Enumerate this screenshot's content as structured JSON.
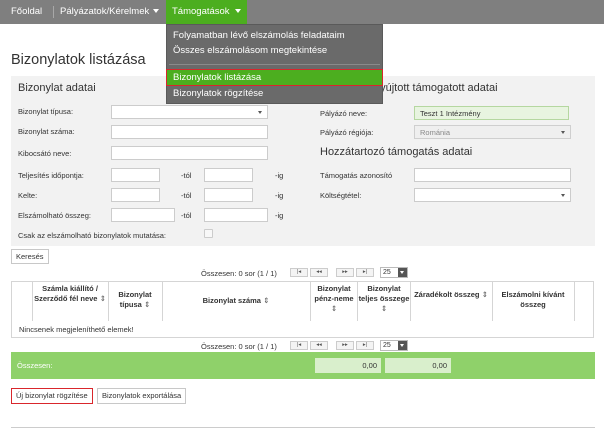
{
  "nav": {
    "home": "Főoldal",
    "requests": "Pályázatok/Kérelmek",
    "subsidies": "Támogatások"
  },
  "dropdown": {
    "items": [
      "Folyamatban lévő elszámolás feladataim",
      "Összes elszámolásom megtekintése",
      "Bizonylatok listázása",
      "Bizonylatok rögzítése"
    ],
    "selected_index": 2
  },
  "page": {
    "title": "Bizonylatok listázása"
  },
  "doc_section": {
    "title": "Bizonylat adatai",
    "type_label": "Bizonylat típusa:",
    "number_label": "Bizonylat száma:",
    "issuer_label": "Kibocsátó neve:",
    "performance_label": "Teljesítés időpontja:",
    "date_label": "Kelte:",
    "amount_label": "Elszámolható összeg:",
    "from_suffix": "-tól",
    "to_suffix": "-ig",
    "only_eligible_label": "Csak az elszámolható bizonylatok mutatása:"
  },
  "applicant_section": {
    "title": "...nyújtott támogatott adatai",
    "title_visible": "nyújtott támogatott adatai",
    "name_label": "Pályázó neve:",
    "name_value": "Teszt 1 Intézmény",
    "region_label": "Pályázó régiója:",
    "region_value": "Románia"
  },
  "support_section": {
    "title": "Hozzátartozó támogatás adatai",
    "id_label": "Támogatás azonosító",
    "cost_label": "Költségtétel:"
  },
  "search_button": "Keresés",
  "pager": {
    "summary": "Összesen: 0 sor (1 / 1)",
    "page_size": "25",
    "first": "|◂",
    "prev": "◂◂",
    "next": "▸▸",
    "last": "▸|"
  },
  "table": {
    "headers": [
      "Számla kiállító / Szerződő fél neve",
      "Bizonylat típusa",
      "Bizonylat száma",
      "Bizonylat pénz-neme",
      "Bizonylat teljes összege",
      "Záradékolt összeg",
      "Elszámolni kívánt összeg"
    ],
    "sort_icon": "⇕",
    "empty_text": "Nincsenek megjeleníthető elemek!"
  },
  "totals": {
    "label": "Összesen:",
    "value1": "0,00",
    "value2": "0,00"
  },
  "actions": {
    "new_doc": "Új bizonylat rögzítése",
    "export": "Bizonylatok exportálása"
  },
  "colors": {
    "nav_bg": "#7f7f7f",
    "accent_green": "#4cae1f",
    "highlight_red": "#d9262c",
    "sum_bar": "#8fd16a"
  }
}
